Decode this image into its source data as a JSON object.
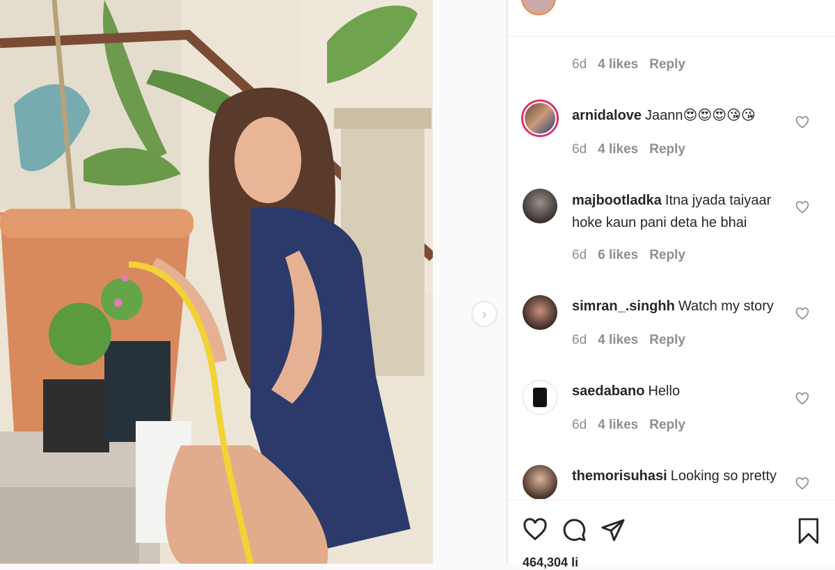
{
  "nav": {
    "next_arrow": "›"
  },
  "top_comment": {
    "partial_text": "°°°°",
    "age": "6d",
    "likes": "4 likes",
    "reply": "Reply"
  },
  "comments": [
    {
      "username": "arnidalove",
      "text": "Jaann😍😍😍😘😘",
      "age": "6d",
      "likes": "4 likes",
      "reply": "Reply"
    },
    {
      "username": "majbootladka",
      "text": "Itna jyada taiyaar hoke kaun pani deta he bhai",
      "age": "6d",
      "likes": "6 likes",
      "reply": "Reply"
    },
    {
      "username": "simran_.singhh",
      "text": "Watch my story",
      "age": "6d",
      "likes": "4 likes",
      "reply": "Reply"
    },
    {
      "username": "saedabano",
      "text": "Hello",
      "age": "6d",
      "likes": "4 likes",
      "reply": "Reply"
    },
    {
      "username": "themorisuhasi",
      "text": "Looking so pretty",
      "age": "",
      "likes": "",
      "reply": ""
    }
  ],
  "footer": {
    "likes_count": "464,304 li"
  },
  "colors": {
    "ring": "#e1306c",
    "muted": "#8e8e8e",
    "text": "#262626"
  }
}
